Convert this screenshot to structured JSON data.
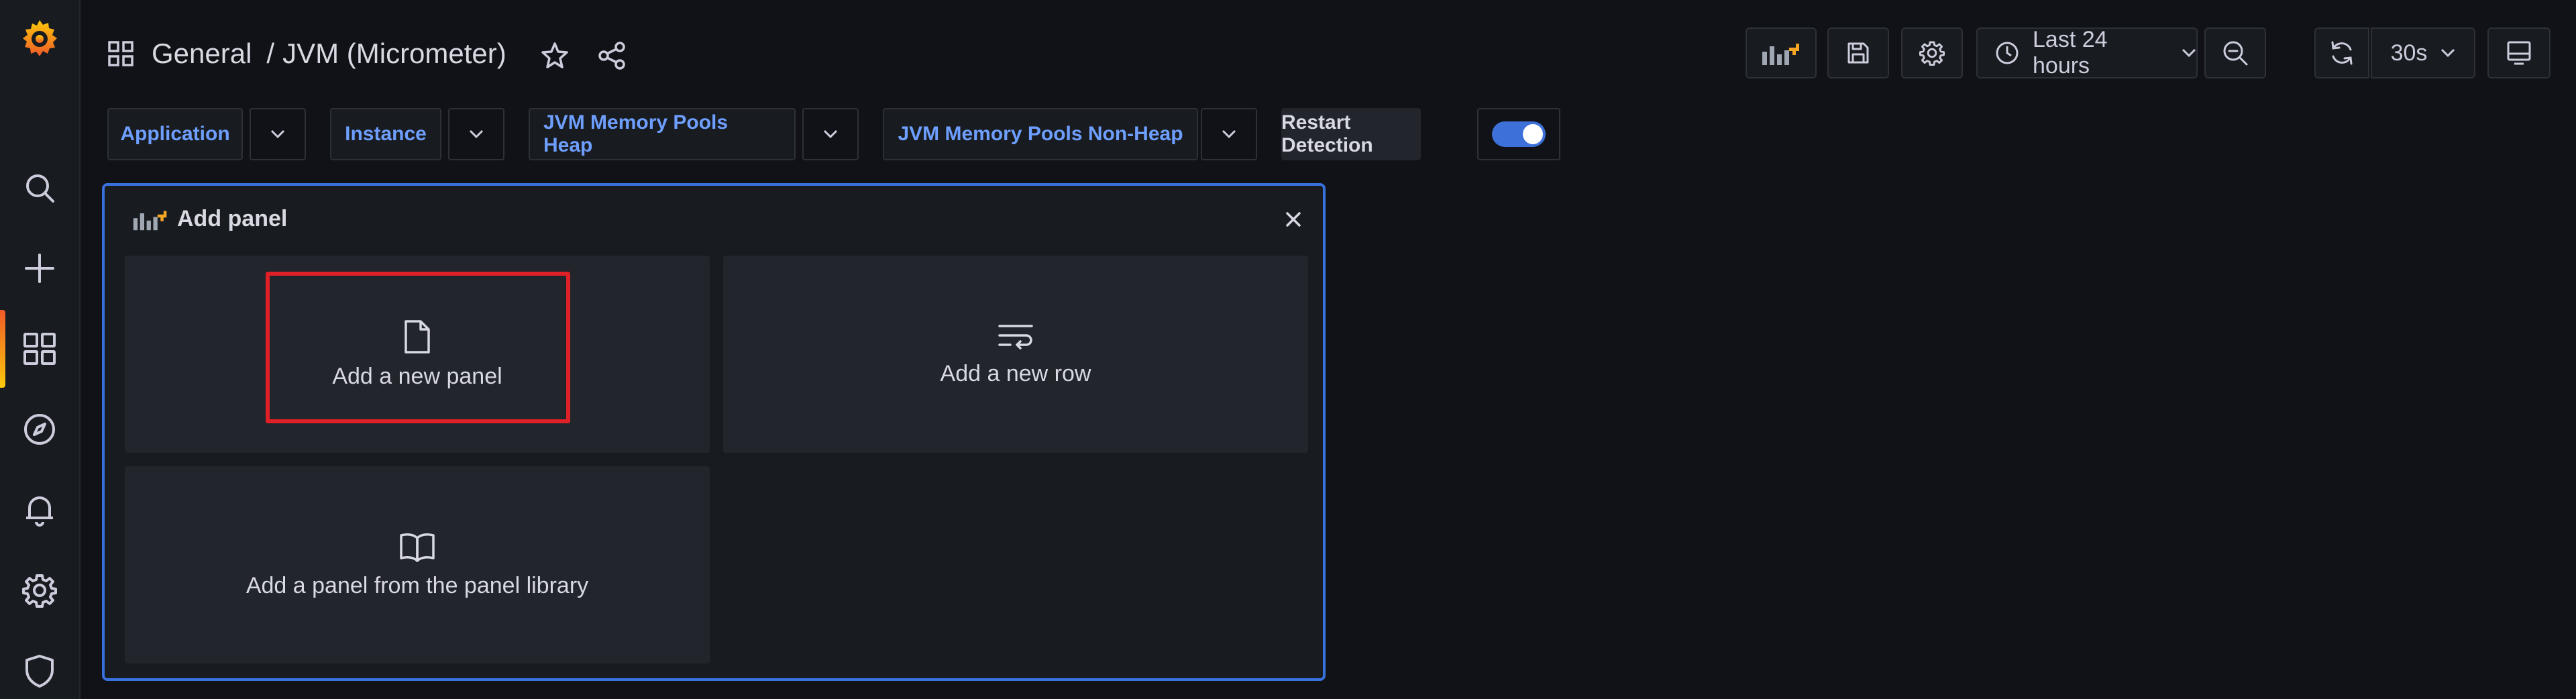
{
  "breadcrumb": {
    "folder": "General",
    "separator": "/",
    "dashboard": "JVM (Micrometer)"
  },
  "toolbar": {
    "time_range": "Last 24 hours",
    "refresh_interval": "30s"
  },
  "variables": [
    {
      "label": "Application"
    },
    {
      "label": "Instance"
    },
    {
      "label": "JVM Memory Pools Heap"
    },
    {
      "label": "JVM Memory Pools Non-Heap"
    }
  ],
  "restart_detection": {
    "label": "Restart Detection",
    "enabled": true
  },
  "add_panel": {
    "title": "Add panel",
    "options": {
      "new_panel": "Add a new panel",
      "new_row": "Add a new row",
      "library": "Add a panel from the panel library"
    }
  },
  "colors": {
    "accent_blue": "#3871dc",
    "highlight_red": "#e02027",
    "logo_orange": "#f05a28"
  }
}
